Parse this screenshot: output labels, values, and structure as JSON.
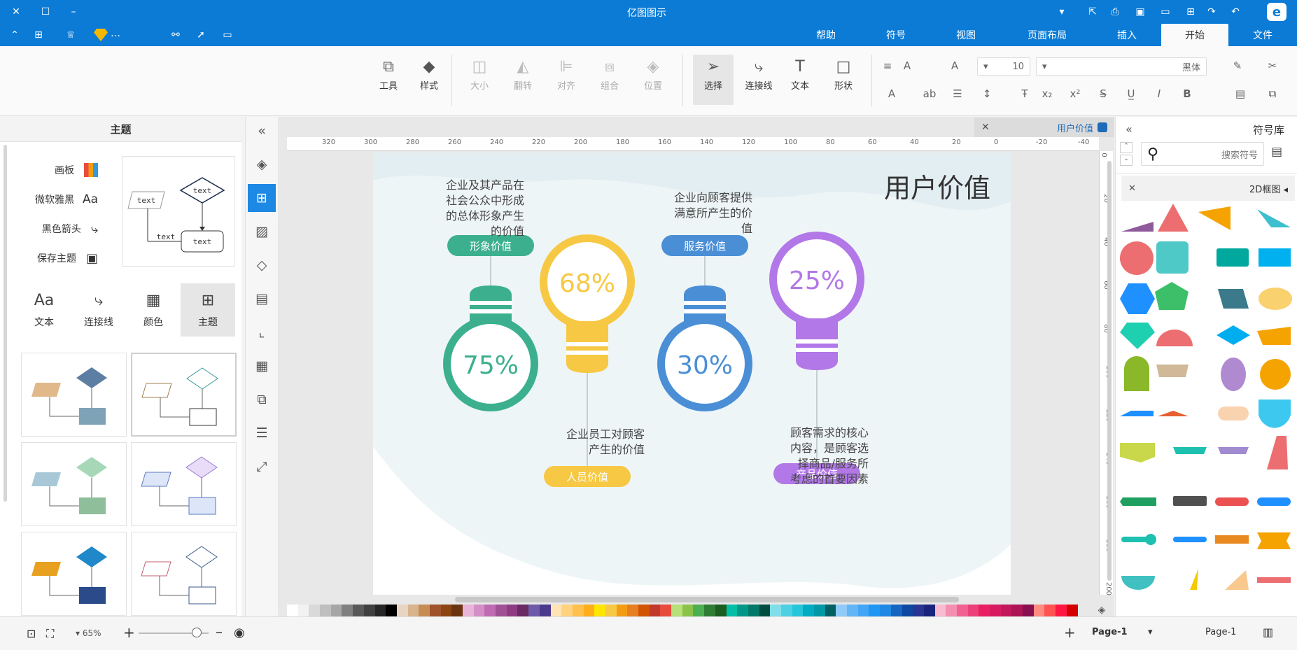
{
  "app": {
    "title": "亿图图示"
  },
  "tabs": [
    {
      "label": "文件"
    },
    {
      "label": "开始"
    },
    {
      "label": "插入"
    },
    {
      "label": "页面布局"
    },
    {
      "label": "视图"
    },
    {
      "label": "符号"
    },
    {
      "label": "帮助"
    }
  ],
  "ribbon": {
    "tools": [
      {
        "label": "工具"
      },
      {
        "label": "样式"
      },
      {
        "label": "大小"
      },
      {
        "label": "翻转"
      },
      {
        "label": "对齐"
      },
      {
        "label": "组合"
      },
      {
        "label": "位置"
      },
      {
        "label": "选择"
      },
      {
        "label": "连接线"
      },
      {
        "label": "文本"
      },
      {
        "label": "形状"
      }
    ],
    "font_size": "10",
    "font_name": "黑体"
  },
  "left_panel": {
    "title": "主题",
    "items": [
      {
        "label": "画板"
      },
      {
        "label": "微软雅黑"
      },
      {
        "label": "黑色箭头"
      },
      {
        "label": "保存主题"
      }
    ],
    "preview_texts": [
      "text",
      "text",
      "text",
      "text"
    ],
    "tabs": [
      {
        "label": "主题"
      },
      {
        "label": "颜色"
      },
      {
        "label": "连接线"
      },
      {
        "label": "文本"
      }
    ]
  },
  "doc_tab": {
    "label": "用户价值"
  },
  "right_panel": {
    "title": "符号库",
    "search_placeholder": "搜索符号",
    "category": "2D框图"
  },
  "infographic": {
    "title": "用户价值",
    "blocks": [
      {
        "label": "形象价值",
        "percent": "75%",
        "desc": [
          "企业及其产品在",
          "社会公众中形成",
          "的总体形象产生",
          "的价值"
        ],
        "color": "#3cb08e"
      },
      {
        "label": "人员价值",
        "percent": "68%",
        "desc": [
          "企业员工对顾客",
          "产生的价值"
        ],
        "color": "#f7c843"
      },
      {
        "label": "服务价值",
        "percent": "30%",
        "desc": [
          "企业向顾客提供",
          "满意所产生的价",
          "值"
        ],
        "color": "#4a8fd6"
      },
      {
        "label": "产品价值",
        "percent": "25%",
        "desc": [
          "顾客需求的核心",
          "内容，是顾客选",
          "择商品/服务所",
          "考虑的首要因素"
        ],
        "color": "#b278e8"
      }
    ]
  },
  "ruler": {
    "h_ticks": [
      "-40",
      "-20",
      "0",
      "20",
      "40",
      "60",
      "80",
      "100",
      "120",
      "140",
      "160",
      "180",
      "200",
      "220",
      "240",
      "260",
      "280",
      "300",
      "320"
    ],
    "v_ticks": [
      "0",
      "20",
      "40",
      "60",
      "80",
      "100",
      "120",
      "140",
      "160",
      "180",
      "200"
    ]
  },
  "status": {
    "zoom": "65%",
    "page_select": "Page-1",
    "page_tab": "Page-1"
  },
  "colors": {
    "accent": "#0b7bd6",
    "palette": [
      "#ffffff",
      "#f2f2f2",
      "#d9d9d9",
      "#bfbfbf",
      "#a6a6a6",
      "#808080",
      "#595959",
      "#404040",
      "#262626",
      "#000000",
      "#e7d4c2",
      "#d9b38c",
      "#c68c53",
      "#a0522d",
      "#8b4513",
      "#6b3410",
      "#e8b4d8",
      "#d48fc6",
      "#c06ab4",
      "#a05095",
      "#8e3b84",
      "#6a2a63",
      "#6e5aa8",
      "#4b3a8c",
      "#ffe4b5",
      "#ffd27f",
      "#ffc04c",
      "#ffae19",
      "#ffe600",
      "#f7c843",
      "#f39c12",
      "#e67e22",
      "#d35400",
      "#c0392b",
      "#e74c3c",
      "#b7e07b",
      "#8bc34a",
      "#4caf50",
      "#2e7d32",
      "#1b5e20",
      "#00bfa5",
      "#009688",
      "#00796b",
      "#004d40",
      "#80deea",
      "#4dd0e1",
      "#26c6da",
      "#00acc1",
      "#0097a7",
      "#006064",
      "#90caf9",
      "#64b5f6",
      "#42a5f5",
      "#2196f3",
      "#1e88e5",
      "#1565c0",
      "#0d47a1",
      "#283593",
      "#1a237e",
      "#f8bbd0",
      "#f48fb1",
      "#f06292",
      "#ec407a",
      "#e91e63",
      "#d81b60",
      "#c2185b",
      "#ad1457",
      "#880e4f",
      "#ff8a80",
      "#ff5252",
      "#ff1744",
      "#d50000"
    ]
  }
}
